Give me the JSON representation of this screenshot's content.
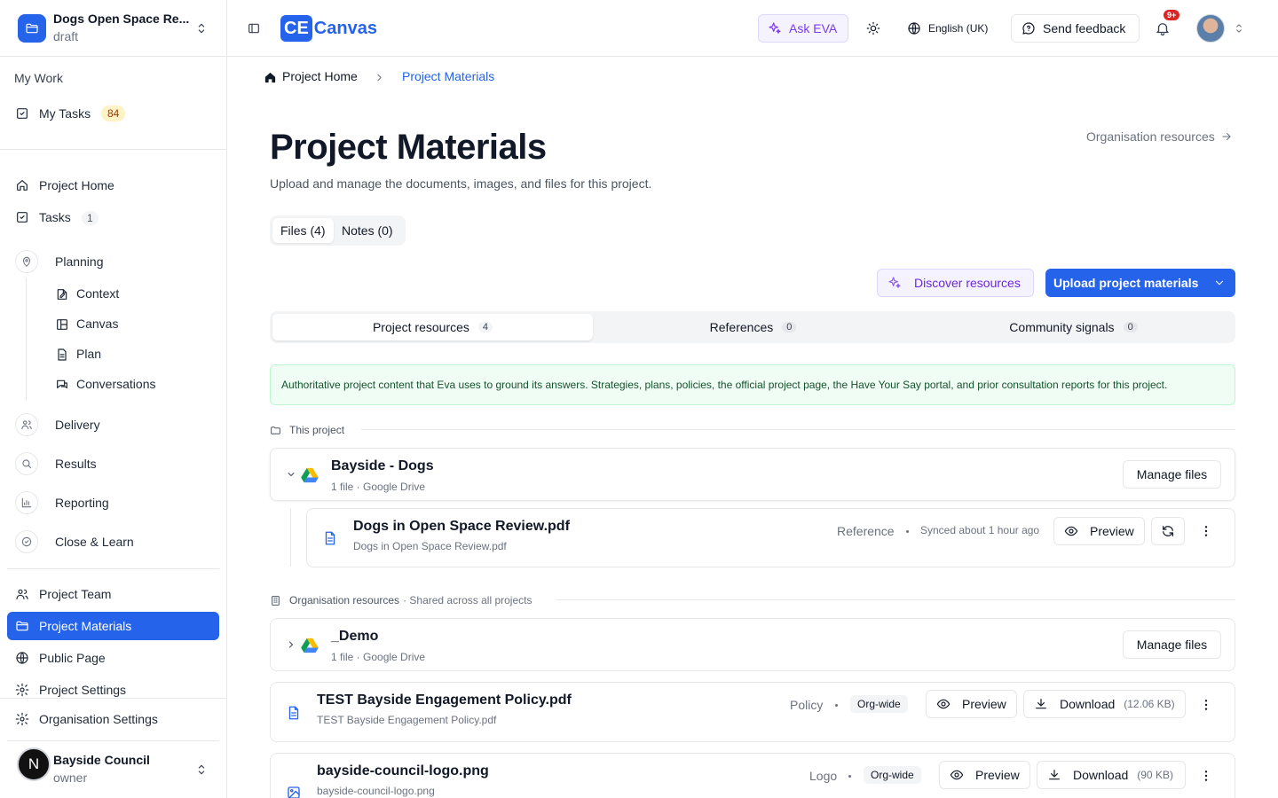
{
  "project": {
    "name": "Dogs Open Space Re...",
    "status": "draft"
  },
  "sidebar": {
    "my_work_label": "My Work",
    "my_tasks": {
      "label": "My Tasks",
      "count": "84"
    },
    "project_home": "Project Home",
    "tasks": {
      "label": "Tasks",
      "count": "1"
    },
    "planning": "Planning",
    "planning_children": [
      "Context",
      "Canvas",
      "Plan",
      "Conversations"
    ],
    "delivery": "Delivery",
    "results": "Results",
    "reporting": "Reporting",
    "close_learn": "Close & Learn",
    "project_team": "Project Team",
    "project_materials": "Project Materials",
    "public_page": "Public Page",
    "project_settings": "Project Settings",
    "organisation_settings": "Organisation Settings",
    "org": {
      "initial": "N",
      "name": "Bayside Council",
      "role": "owner"
    }
  },
  "header": {
    "logo_mark": "CE",
    "logo_text": "Canvas",
    "ask_eva": "Ask EVA",
    "language": "English (UK)",
    "send_feedback": "Send feedback",
    "notifications_badge": "9+"
  },
  "breadcrumb": {
    "home": "Project Home",
    "current": "Project Materials"
  },
  "page": {
    "title": "Project Materials",
    "subtitle": "Upload and manage the documents, images, and files for this project.",
    "org_resources_link": "Organisation resources",
    "seg_files": "Files (4)",
    "seg_notes": "Notes (0)",
    "discover": "Discover resources",
    "upload": "Upload project materials"
  },
  "tabs": [
    {
      "label": "Project resources",
      "count": "4"
    },
    {
      "label": "References",
      "count": "0"
    },
    {
      "label": "Community signals",
      "count": "0"
    }
  ],
  "info_text": "Authoritative project content that Eva uses to ground its answers. Strategies, plans, policies, the official project page, the Have Your Say portal, and prior consultation reports for this project.",
  "this_project": {
    "heading": "This project",
    "folder": {
      "name": "Bayside - Dogs",
      "meta": "1 file · Google Drive",
      "manage": "Manage files"
    },
    "file": {
      "title": "Dogs in Open Space Review.pdf",
      "sub": "Dogs in Open Space Review.pdf",
      "category": "Reference",
      "synced": "Synced about 1 hour ago",
      "preview": "Preview"
    }
  },
  "org_resources": {
    "heading": "Organisation resources",
    "note": "· Shared across all projects",
    "folder": {
      "name": "_Demo",
      "meta": "1 file · Google Drive",
      "manage": "Manage files"
    },
    "files": [
      {
        "title": "TEST Bayside Engagement Policy.pdf",
        "sub": "TEST Bayside Engagement Policy.pdf",
        "category": "Policy",
        "pill": "Org-wide",
        "preview": "Preview",
        "download": "Download",
        "size": "(12.06 KB)"
      },
      {
        "title": "bayside-council-logo.png",
        "sub": "bayside-council-logo.png",
        "category": "Logo",
        "pill": "Org-wide",
        "preview": "Preview",
        "download": "Download",
        "size": "(90 KB)"
      }
    ]
  },
  "colors": {
    "primary": "#2563eb",
    "eva_purple": "#6d28d9",
    "info_green": "#f0fdf4"
  }
}
